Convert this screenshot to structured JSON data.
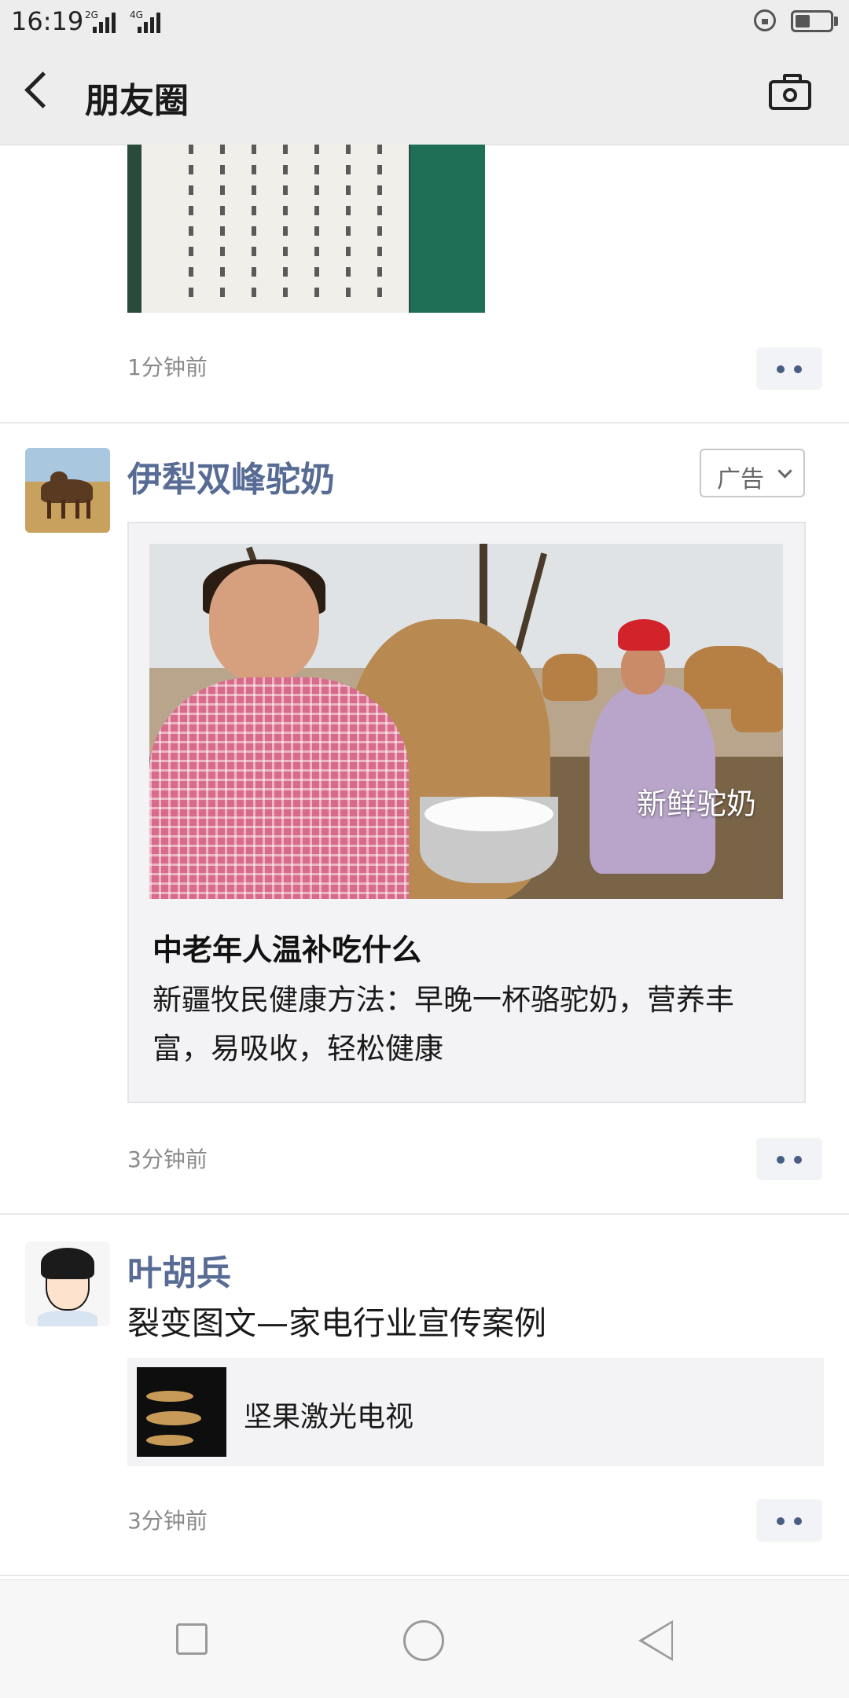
{
  "status_bar": {
    "time": "16:19",
    "network1": "2G",
    "network2": "4G"
  },
  "nav": {
    "title": "朋友圈"
  },
  "post1": {
    "timestamp": "1分钟前"
  },
  "post2": {
    "username": "伊犁双峰驼奶",
    "ad_badge": "广告",
    "photo_caption": "新鲜驼奶",
    "title": "中老年人温补吃什么",
    "description": "新疆牧民健康方法：早晚一杯骆驼奶，营养丰富，易吸收，轻松健康",
    "timestamp": "3分钟前"
  },
  "post3": {
    "username": "叶胡兵",
    "text": "裂变图文—家电行业宣传案例",
    "link_title": "坚果激光电视",
    "timestamp": "3分钟前"
  },
  "colors": {
    "link_blue": "#576b95",
    "nav_bg": "#ededed",
    "card_bg": "#f3f3f5"
  }
}
